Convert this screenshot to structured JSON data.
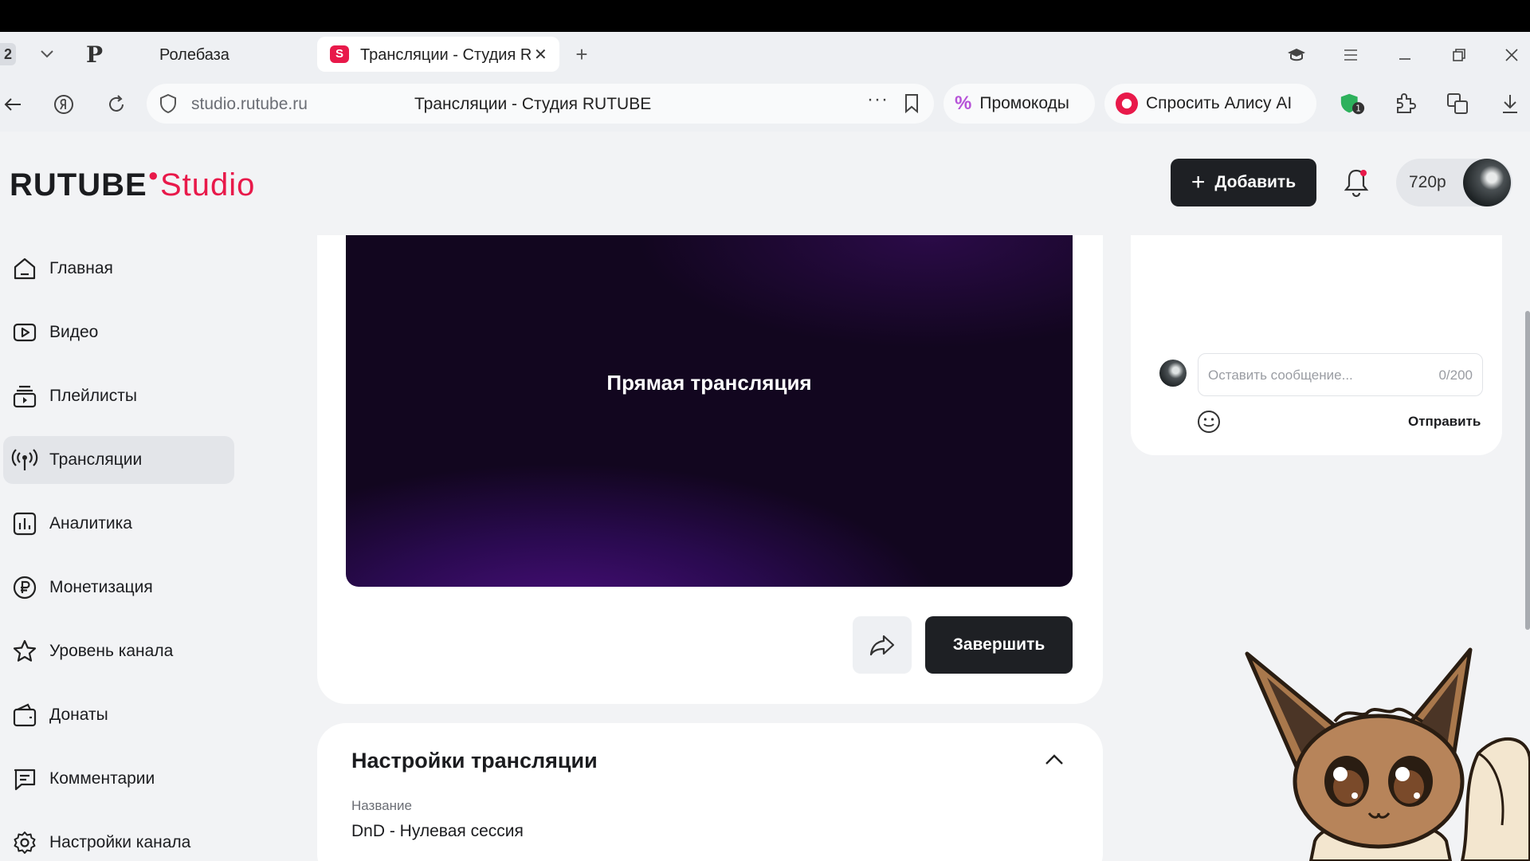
{
  "browser": {
    "tab_count": "2",
    "tabs": [
      {
        "label": "Ролебаза"
      },
      {
        "label": "Трансляции - Студия RUTUBE"
      }
    ],
    "address": {
      "url": "studio.rutube.ru",
      "page_title": "Трансляции - Студия RUTUBE"
    },
    "promo_label": "Промокоды",
    "alice_label": "Спросить Алису AI",
    "ext_badge": "1"
  },
  "header": {
    "logo_main": "RUTUBE",
    "logo_sub": "Studio",
    "add_label": "Добавить",
    "quality": "720p"
  },
  "sidebar": {
    "items": [
      {
        "label": "Главная",
        "icon": "home-icon"
      },
      {
        "label": "Видео",
        "icon": "video-icon"
      },
      {
        "label": "Плейлисты",
        "icon": "playlist-icon"
      },
      {
        "label": "Трансляции",
        "icon": "broadcast-icon",
        "active": true
      },
      {
        "label": "Аналитика",
        "icon": "analytics-icon"
      },
      {
        "label": "Монетизация",
        "icon": "ruble-icon"
      },
      {
        "label": "Уровень канала",
        "icon": "star-icon"
      },
      {
        "label": "Донаты",
        "icon": "wallet-icon"
      },
      {
        "label": "Комментарии",
        "icon": "comments-icon"
      },
      {
        "label": "Настройки канала",
        "icon": "gear-icon"
      }
    ]
  },
  "player": {
    "title": "Прямая трансляция",
    "finish_label": "Завершить"
  },
  "settings": {
    "title": "Настройки трансляции",
    "name_label": "Название",
    "name_value": "DnD - Нулевая сессия"
  },
  "chat": {
    "placeholder": "Оставить сообщение...",
    "counter": "0/200",
    "send_label": "Отправить"
  },
  "colors": {
    "accent": "#e8194a",
    "dark_button": "#1e2024",
    "background": "#f2f3f5"
  }
}
